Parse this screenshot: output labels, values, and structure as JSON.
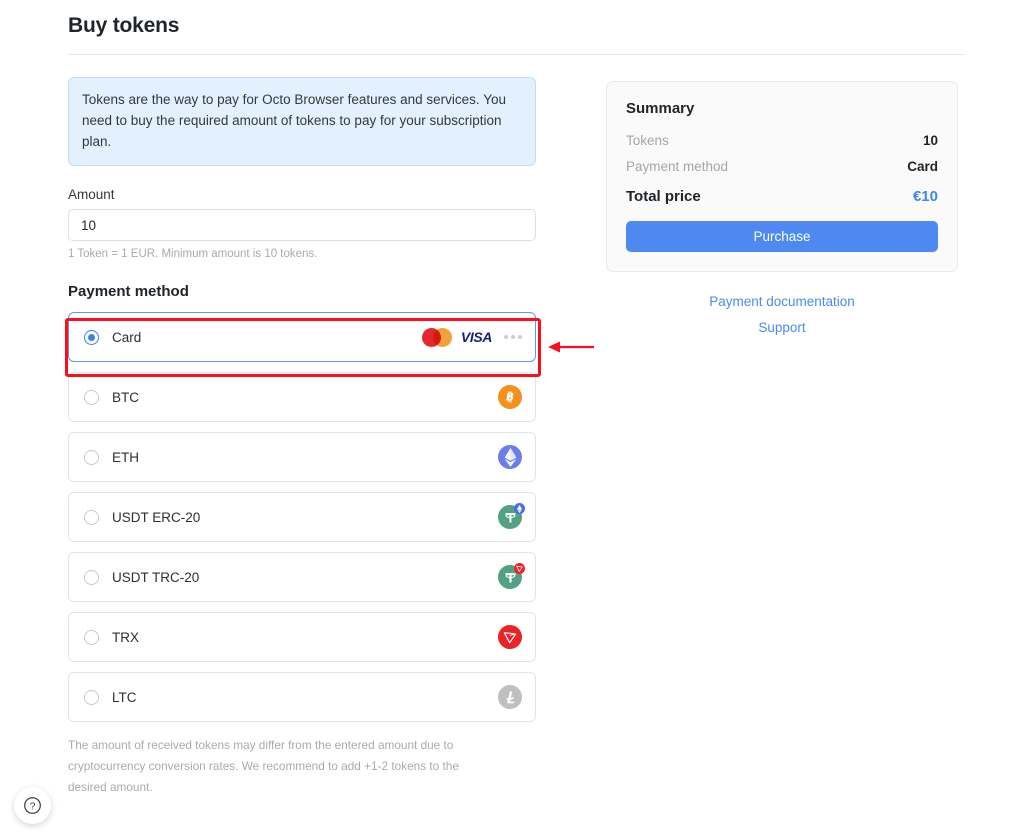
{
  "page": {
    "title": "Buy tokens",
    "info_banner": "Tokens are the way to pay for Octo Browser features and services. You need to buy the required amount of tokens to pay for your subscription plan.",
    "footnote": "The amount of received tokens may differ from the entered amount due to cryptocurrency conversion rates. We recommend to add +1-2 tokens to the desired amount."
  },
  "amount": {
    "label": "Amount",
    "value": "10",
    "placeholder": "10",
    "hint": "1 Token = 1 EUR. Minimum amount is 10 tokens."
  },
  "payment_method": {
    "section_title": "Payment method",
    "selected": "Card",
    "options": [
      {
        "label": "Card",
        "icon": "card-brands-icon",
        "selected": true,
        "overflow": "..."
      },
      {
        "label": "BTC",
        "icon": "bitcoin-icon",
        "glyph": "Ƀ",
        "selected": false
      },
      {
        "label": "ETH",
        "icon": "ethereum-icon",
        "glyph": "◆",
        "selected": false
      },
      {
        "label": "USDT ERC-20",
        "icon": "tether-erc20-icon",
        "glyph": "₮",
        "badge": "ethereum-badge-icon",
        "selected": false
      },
      {
        "label": "USDT TRC-20",
        "icon": "tether-trc20-icon",
        "glyph": "₮",
        "badge": "tron-badge-icon",
        "selected": false
      },
      {
        "label": "TRX",
        "icon": "tron-icon",
        "glyph": "▽",
        "selected": false
      },
      {
        "label": "LTC",
        "icon": "litecoin-icon",
        "glyph": "Ł",
        "selected": false
      }
    ],
    "card_brands": {
      "mastercard": "mastercard-icon",
      "visa": "VISA"
    }
  },
  "summary": {
    "title": "Summary",
    "rows": [
      {
        "key": "Tokens",
        "value": "10"
      },
      {
        "key": "Payment method",
        "value": "Card"
      }
    ],
    "total_label": "Total price",
    "total_value": "€10",
    "purchase_label": "Purchase"
  },
  "links": [
    {
      "label": "Payment documentation"
    },
    {
      "label": "Support"
    }
  ],
  "help": {
    "label": "?"
  },
  "colors": {
    "accent": "#4d89f0",
    "link": "#4a8bf0",
    "banner_bg": "#e2f1fd",
    "annotation": "#fc0d1c",
    "bitcoin": "#f2921d",
    "ethereum": "#6b7ee8",
    "tether": "#53a183",
    "tron": "#eb2226",
    "litecoin": "#bfbfbf"
  }
}
